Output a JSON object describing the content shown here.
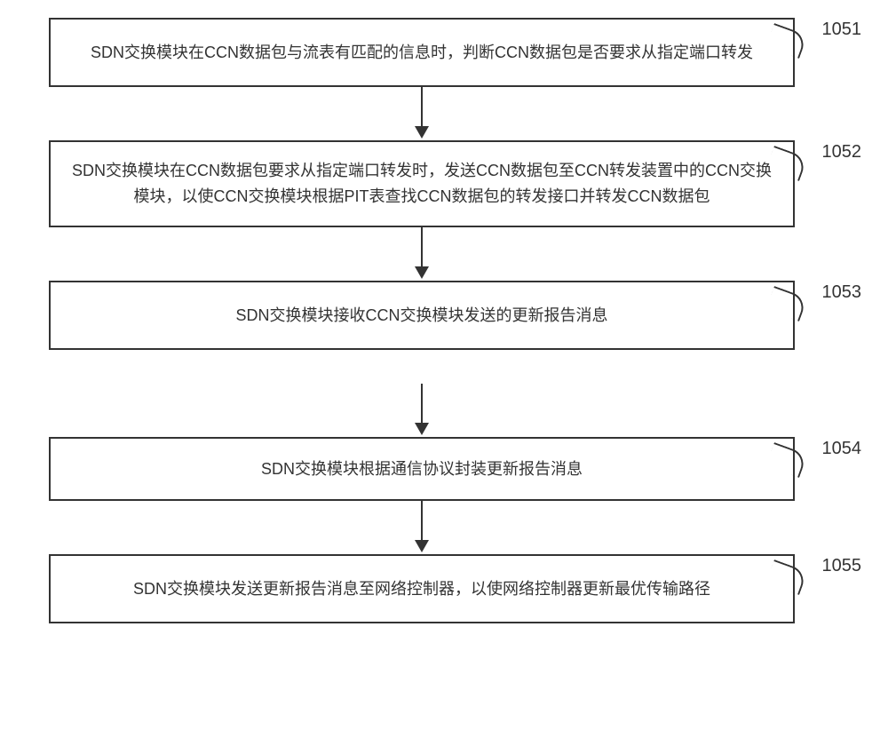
{
  "chart_data": {
    "type": "flowchart",
    "direction": "top-to-bottom",
    "nodes": [
      {
        "id": "1051",
        "text": "SDN交换模块在CCN数据包与流表有匹配的信息时，判断CCN数据包是否要求从指定端口转发"
      },
      {
        "id": "1052",
        "text": "SDN交换模块在CCN数据包要求从指定端口转发时，发送CCN数据包至CCN转发装置中的CCN交换模块，以使CCN交换模块根据PIT表查找CCN数据包的转发接口并转发CCN数据包"
      },
      {
        "id": "1053",
        "text": "SDN交换模块接收CCN交换模块发送的更新报告消息"
      },
      {
        "id": "1054",
        "text": "SDN交换模块根据通信协议封装更新报告消息"
      },
      {
        "id": "1055",
        "text": "SDN交换模块发送更新报告消息至网络控制器，以使网络控制器更新最优传输路径"
      }
    ],
    "edges": [
      {
        "from": "1051",
        "to": "1052"
      },
      {
        "from": "1052",
        "to": "1053"
      },
      {
        "from": "1053",
        "to": "1054"
      },
      {
        "from": "1054",
        "to": "1055"
      }
    ]
  },
  "steps": {
    "s1": {
      "label": "1051",
      "text": "SDN交换模块在CCN数据包与流表有匹配的信息时，判断CCN数据包是否要求从指定端口转发"
    },
    "s2": {
      "label": "1052",
      "text": "SDN交换模块在CCN数据包要求从指定端口转发时，发送CCN数据包至CCN转发装置中的CCN交换模块，以使CCN交换模块根据PIT表查找CCN数据包的转发接口并转发CCN数据包"
    },
    "s3": {
      "label": "1053",
      "text": "SDN交换模块接收CCN交换模块发送的更新报告消息"
    },
    "s4": {
      "label": "1054",
      "text": "SDN交换模块根据通信协议封装更新报告消息"
    },
    "s5": {
      "label": "1055",
      "text": "SDN交换模块发送更新报告消息至网络控制器，以使网络控制器更新最优传输路径"
    }
  }
}
